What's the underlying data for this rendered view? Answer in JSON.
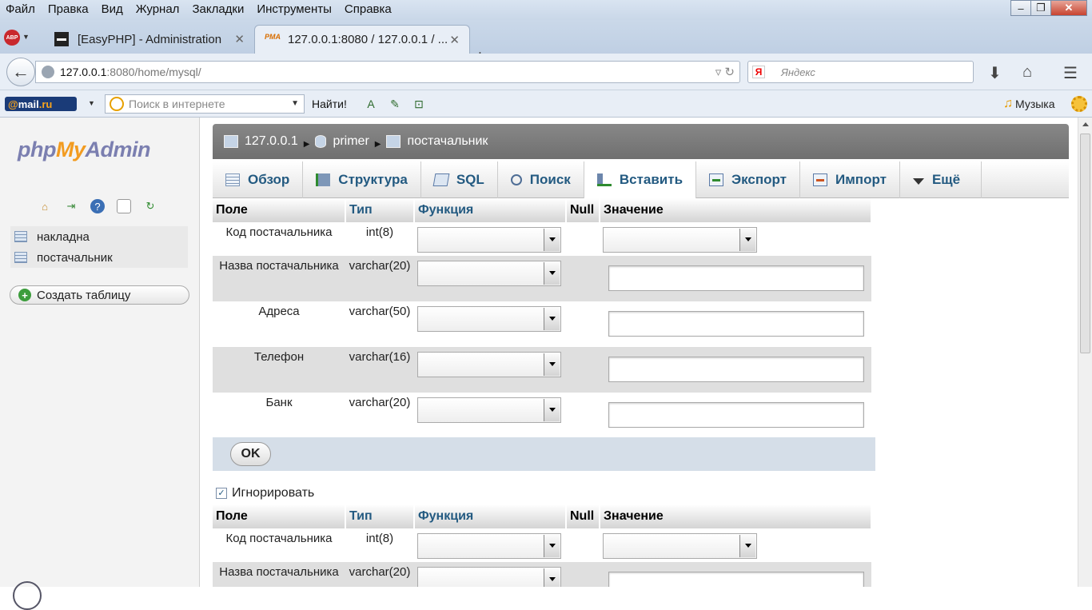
{
  "menu": [
    "Файл",
    "Правка",
    "Вид",
    "Журнал",
    "Закладки",
    "Инструменты",
    "Справка"
  ],
  "tabs": [
    {
      "label": "[EasyPHP] - Administration"
    },
    {
      "label": "127.0.0.1:8080 / 127.0.0.1 / ..."
    }
  ],
  "nav": {
    "url_host": "127.0.0.1",
    "url_rest": ":8080/home/mysql/",
    "search_placeholder": "Яндекс"
  },
  "bookmarks": {
    "mailru_at": "@",
    "mailru_brand": "mail",
    "mailru_tld": ".ru",
    "search_placeholder": "Поиск в интернете",
    "find_label": "Найти!",
    "music_label": "Музыка"
  },
  "sidebar": {
    "logo_php": "php",
    "logo_my": "My",
    "logo_admin": "Admin",
    "tables": [
      "накладна",
      "постачальник"
    ],
    "create_label": "Создать таблицу"
  },
  "breadcrumb": {
    "server": "127.0.0.1",
    "database": "primer",
    "table": "постачальник"
  },
  "main_tabs": [
    {
      "label": "Обзор",
      "icon": "browse-icon"
    },
    {
      "label": "Структура",
      "icon": "structure-icon"
    },
    {
      "label": "SQL",
      "icon": "sql-icon"
    },
    {
      "label": "Поиск",
      "icon": "search-icon"
    },
    {
      "label": "Вставить",
      "icon": "insert-icon",
      "active": true
    },
    {
      "label": "Экспорт",
      "icon": "export-icon"
    },
    {
      "label": "Импорт",
      "icon": "import-icon"
    },
    {
      "label": "Ещё",
      "icon": "more-icon"
    }
  ],
  "table_headers": {
    "field": "Поле",
    "type": "Тип",
    "function": "Функция",
    "null": "Null",
    "value": "Значение"
  },
  "rows": [
    {
      "field": "Код постачальника",
      "type": "int(8)"
    },
    {
      "field": "Назва постачальника",
      "type": "varchar(20)"
    },
    {
      "field": "Адреса",
      "type": "varchar(50)"
    },
    {
      "field": "Телефон",
      "type": "varchar(16)"
    },
    {
      "field": "Банк",
      "type": "varchar(20)"
    }
  ],
  "ok_label": "OK",
  "ignore_label": "Игнорировать",
  "colors": {
    "link": "#235a81",
    "crumb_bg": "#7a7a7a",
    "odd_row": "#ffffff",
    "even_row": "#dfdfdf",
    "ok_bar": "#d5dee8"
  }
}
